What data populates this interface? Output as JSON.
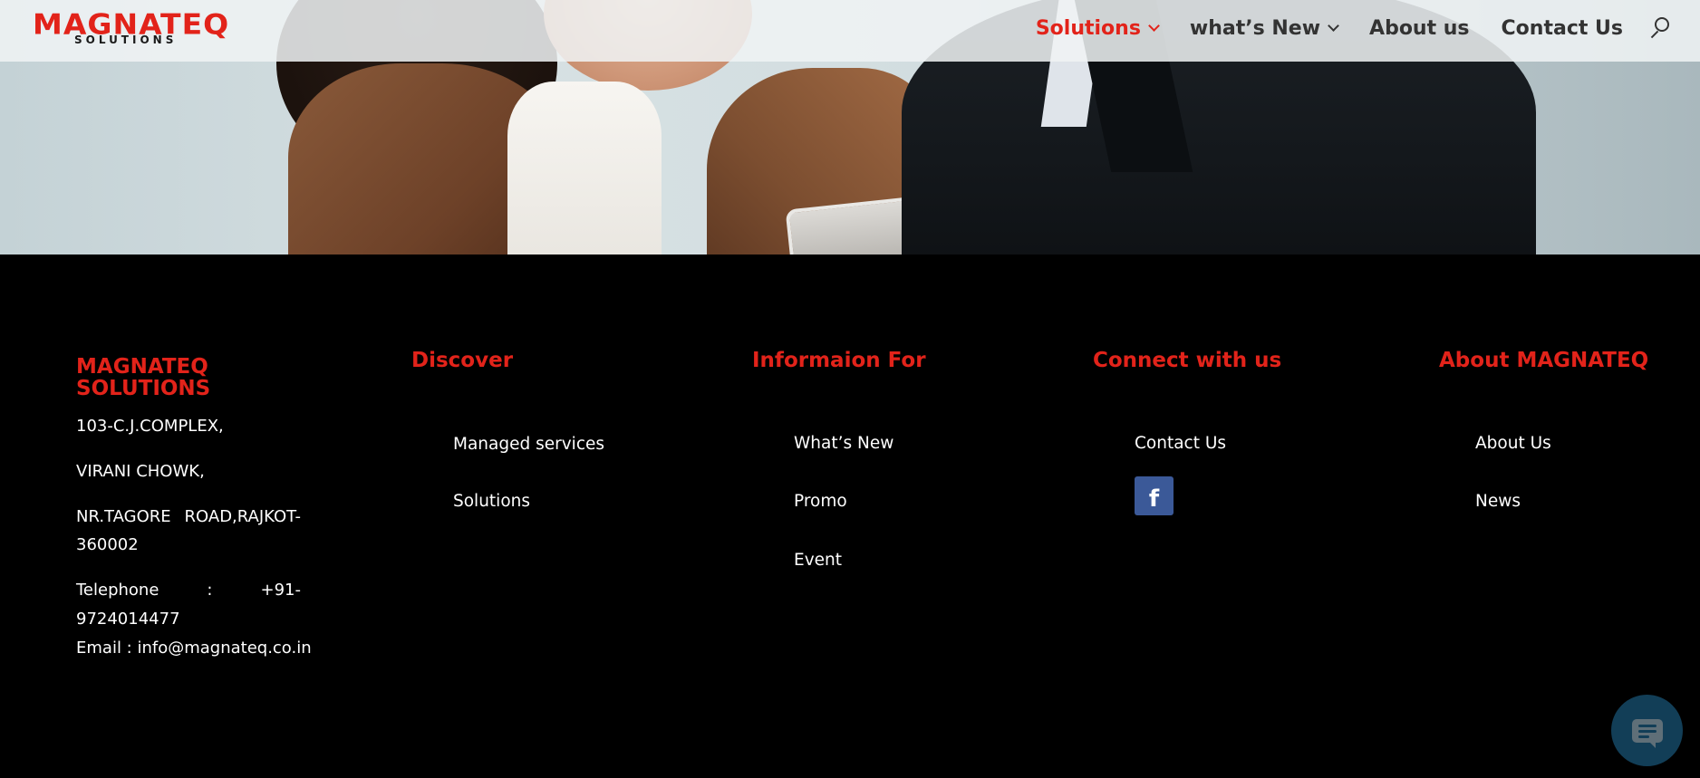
{
  "logo": {
    "word": "MAGNATEQ",
    "sub": "SOLUTIONS"
  },
  "nav": {
    "items": [
      {
        "label": "Solutions",
        "has_dropdown": true,
        "active": true
      },
      {
        "label": "what’s New",
        "has_dropdown": true,
        "active": false
      },
      {
        "label": "About us",
        "has_dropdown": false,
        "active": false
      },
      {
        "label": "Contact Us",
        "has_dropdown": false,
        "active": false
      }
    ]
  },
  "footer": {
    "company": {
      "title": "MAGNATEQ SOLUTIONS",
      "address1": "103-C.J.COMPLEX,",
      "address2": "VIRANI CHOWK,",
      "address3_a": "NR.TAGORE",
      "address3_b": "ROAD,RAJKOT-",
      "address3_c": "360002",
      "phone_label": "Telephone",
      "phone_sep": ":",
      "phone_a": "+91-",
      "phone_b": "9724014477",
      "email": "Email : info@magnateq.co.in"
    },
    "discover": {
      "title": "Discover",
      "links": [
        "Managed services",
        "Solutions"
      ]
    },
    "information": {
      "title": "Informaion For",
      "links": [
        "What’s New",
        "Promo",
        "Event"
      ]
    },
    "connect": {
      "title": "Connect with us",
      "links": [
        "Contact Us"
      ],
      "social_icon": "facebook-icon",
      "social_glyph": "f"
    },
    "about": {
      "title": "About MAGNATEQ",
      "links": [
        "About Us",
        "News"
      ]
    }
  },
  "colors": {
    "brand_red": "#e2231a",
    "footer_bg": "#000000",
    "facebook_blue": "#3b5998",
    "chat_bg": "#123e57"
  },
  "icons": [
    "search-icon",
    "chevron-down-icon",
    "facebook-icon",
    "chat-icon"
  ]
}
